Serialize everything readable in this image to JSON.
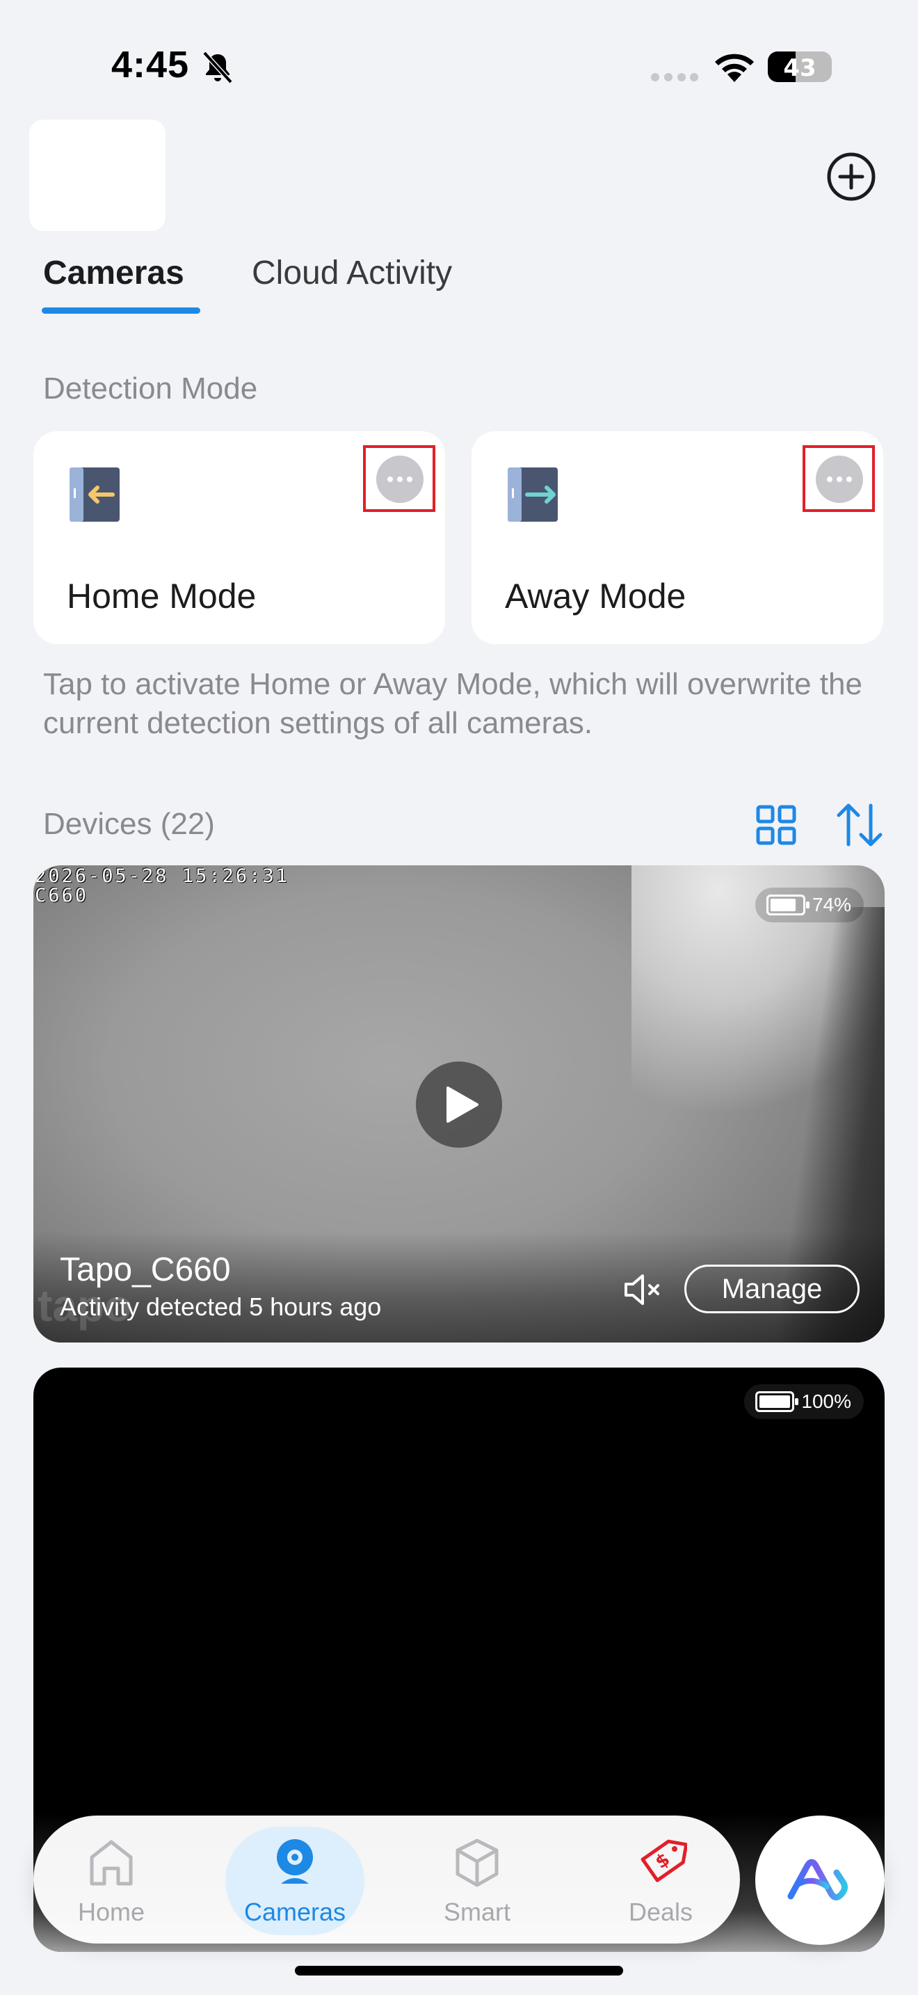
{
  "status_bar": {
    "time": "4:45",
    "battery": "43"
  },
  "tabs": [
    {
      "label": "Cameras",
      "active": true
    },
    {
      "label": "Cloud Activity",
      "active": false
    }
  ],
  "detection": {
    "section_label": "Detection Mode",
    "modes": [
      {
        "label": "Home Mode",
        "icon": "door-enter-icon",
        "arrow_color": "#F5C76B"
      },
      {
        "label": "Away Mode",
        "icon": "door-exit-icon",
        "arrow_color": "#6FD3CF"
      }
    ],
    "hint": "Tap to activate Home or Away Mode, which will overwrite the current detection settings of all cameras."
  },
  "devices": {
    "section_label": "Devices (22)",
    "cameras": [
      {
        "osd_time": "2026-05-28 15:26:31",
        "osd_name": "C660",
        "battery": "74%",
        "battery_level": 0.74,
        "name": "Tapo_C660",
        "activity": "Activity detected 5 hours ago",
        "manage_label": "Manage",
        "watermark": "tapo"
      },
      {
        "battery": "100%",
        "battery_level": 1.0
      }
    ]
  },
  "tabbar": {
    "items": [
      {
        "label": "Home",
        "icon": "house-icon"
      },
      {
        "label": "Cameras",
        "icon": "camera-icon",
        "active": true
      },
      {
        "label": "Smart",
        "icon": "cube-icon"
      },
      {
        "label": "Deals",
        "icon": "price-tag-icon"
      }
    ]
  },
  "colors": {
    "accent": "#1E88E5",
    "highlight_box": "#E0202A",
    "deals": "#E0202A"
  }
}
